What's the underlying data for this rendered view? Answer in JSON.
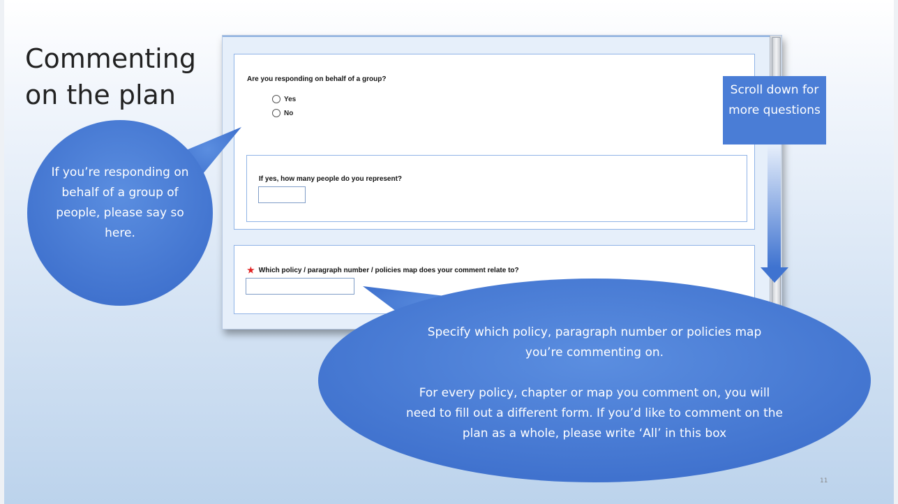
{
  "slide": {
    "title": "Commenting on the plan",
    "number": "11"
  },
  "form": {
    "group_question": "Are you responding on behalf of a group?",
    "options": [
      {
        "label": "Yes",
        "selected": false
      },
      {
        "label": "No",
        "selected": false
      }
    ],
    "people_question": "If yes, how many people do you represent?",
    "people_value": "",
    "policy_question": "Which policy / paragraph number / policies map does your comment relate to?",
    "policy_value": "",
    "required_marker": "★"
  },
  "callouts": {
    "group": "If you’re responding on behalf of a group of people, please say so here.",
    "scroll": "Scroll down for more questions",
    "policy_line1": "Specify which policy, paragraph number or policies map you’re commenting on.",
    "policy_line2": "For every policy, chapter or map you comment on, you will need to fill out a different form.  If you’d like to comment on the plan as a whole, please write ‘All’ in this box"
  },
  "colors": {
    "callout_fill": "#4a7dd6",
    "panel_border": "#8fb3e6",
    "required": "#e02020"
  }
}
